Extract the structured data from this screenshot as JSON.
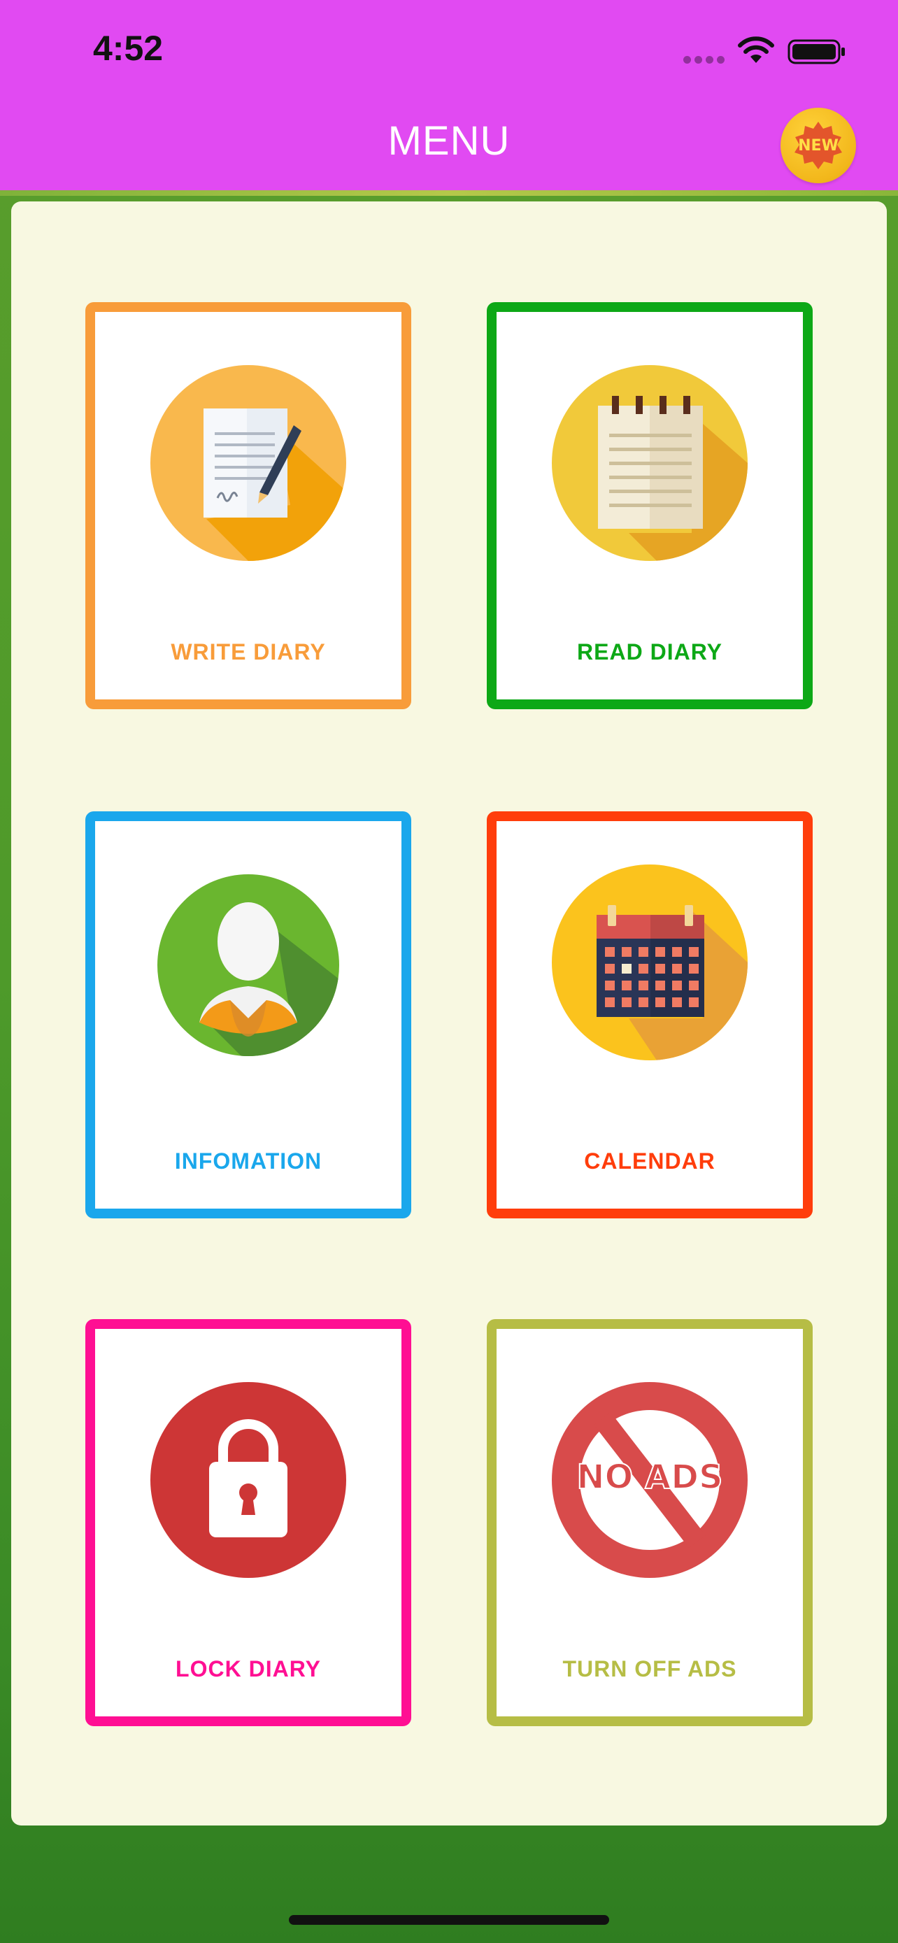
{
  "status_bar": {
    "time": "4:52",
    "icons": [
      "signal-icon",
      "wifi-icon",
      "battery-icon"
    ]
  },
  "header": {
    "title": "MENU",
    "badge_text": "NEW",
    "background_color": "#e14af2"
  },
  "menu": {
    "items": [
      {
        "label": "WRITE DIARY",
        "icon": "write-diary-icon",
        "color": "#f89c3a"
      },
      {
        "label": "READ DIARY",
        "icon": "notepad-icon",
        "color": "#0da816"
      },
      {
        "label": "INFOMATION",
        "icon": "user-avatar-icon",
        "color": "#1aa7ec"
      },
      {
        "label": "CALENDAR",
        "icon": "calendar-icon",
        "color": "#ff3d0b"
      },
      {
        "label": "LOCK DIARY",
        "icon": "lock-icon",
        "color": "#ff0f93"
      },
      {
        "label": "TURN OFF ADS",
        "icon": "no-ads-icon",
        "color": "#b6bd45",
        "icon_text": "NO ADS"
      }
    ]
  }
}
